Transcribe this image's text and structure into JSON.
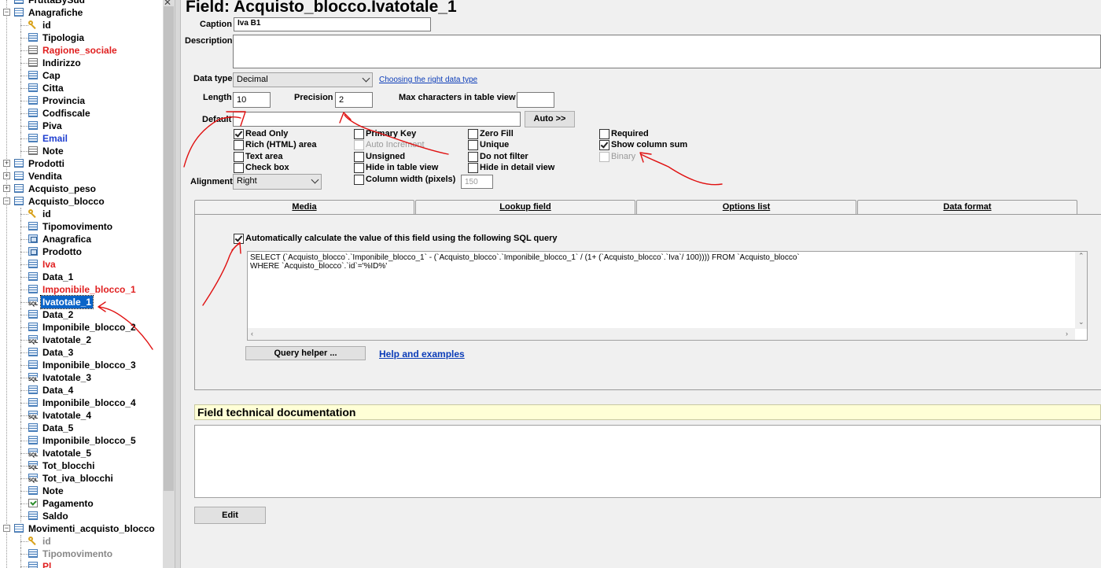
{
  "tree": {
    "items": [
      {
        "label": "FruttaBySud",
        "icon": "database-icon",
        "level": 0,
        "expander": "",
        "color": "normal"
      },
      {
        "label": "Anagrafiche",
        "icon": "table-icon",
        "level": 0,
        "expander": "−",
        "color": "normal"
      },
      {
        "label": "id",
        "icon": "key-icon",
        "level": 1,
        "color": "normal"
      },
      {
        "label": "Tipologia",
        "icon": "field-icon",
        "level": 1,
        "color": "normal"
      },
      {
        "label": "Ragione_sociale",
        "icon": "memo-icon",
        "level": 1,
        "color": "red"
      },
      {
        "label": "Indirizzo",
        "icon": "memo-icon",
        "level": 1,
        "color": "normal"
      },
      {
        "label": "Cap",
        "icon": "field-icon",
        "level": 1,
        "color": "normal"
      },
      {
        "label": "Citta",
        "icon": "field-icon",
        "level": 1,
        "color": "normal"
      },
      {
        "label": "Provincia",
        "icon": "field-icon",
        "level": 1,
        "color": "normal"
      },
      {
        "label": "Codfiscale",
        "icon": "field-icon",
        "level": 1,
        "color": "normal"
      },
      {
        "label": "Piva",
        "icon": "field-icon",
        "level": 1,
        "color": "normal"
      },
      {
        "label": "Email",
        "icon": "field-icon",
        "level": 1,
        "color": "blue"
      },
      {
        "label": "Note",
        "icon": "memo-icon",
        "level": 1,
        "color": "normal"
      },
      {
        "label": "Prodotti",
        "icon": "table-icon",
        "level": 0,
        "expander": "+",
        "color": "normal"
      },
      {
        "label": "Vendita",
        "icon": "table-icon",
        "level": 0,
        "expander": "+",
        "color": "normal"
      },
      {
        "label": "Acquisto_peso",
        "icon": "table-icon",
        "level": 0,
        "expander": "+",
        "color": "normal"
      },
      {
        "label": "Acquisto_blocco",
        "icon": "table-icon",
        "level": 0,
        "expander": "−",
        "color": "normal"
      },
      {
        "label": "id",
        "icon": "key-icon",
        "level": 1,
        "color": "normal"
      },
      {
        "label": "Tipomovimento",
        "icon": "field-icon",
        "level": 1,
        "color": "normal"
      },
      {
        "label": "Anagrafica",
        "icon": "lookup-icon",
        "level": 1,
        "color": "normal"
      },
      {
        "label": "Prodotto",
        "icon": "lookup-icon",
        "level": 1,
        "color": "normal"
      },
      {
        "label": "Iva",
        "icon": "field-icon",
        "level": 1,
        "color": "red"
      },
      {
        "label": "Data_1",
        "icon": "field-icon",
        "level": 1,
        "color": "normal"
      },
      {
        "label": "Imponibile_blocco_1",
        "icon": "field-icon",
        "level": 1,
        "color": "red"
      },
      {
        "label": "Ivatotale_1",
        "icon": "sql-icon",
        "level": 1,
        "color": "selected"
      },
      {
        "label": "Data_2",
        "icon": "field-icon",
        "level": 1,
        "color": "normal"
      },
      {
        "label": "Imponibile_blocco_2",
        "icon": "field-icon",
        "level": 1,
        "color": "normal"
      },
      {
        "label": "Ivatotale_2",
        "icon": "sql-icon",
        "level": 1,
        "color": "normal"
      },
      {
        "label": "Data_3",
        "icon": "field-icon",
        "level": 1,
        "color": "normal"
      },
      {
        "label": "Imponibile_blocco_3",
        "icon": "field-icon",
        "level": 1,
        "color": "normal"
      },
      {
        "label": "Ivatotale_3",
        "icon": "sql-icon",
        "level": 1,
        "color": "normal"
      },
      {
        "label": "Data_4",
        "icon": "field-icon",
        "level": 1,
        "color": "normal"
      },
      {
        "label": "Imponibile_blocco_4",
        "icon": "field-icon",
        "level": 1,
        "color": "normal"
      },
      {
        "label": "Ivatotale_4",
        "icon": "sql-icon",
        "level": 1,
        "color": "normal"
      },
      {
        "label": "Data_5",
        "icon": "field-icon",
        "level": 1,
        "color": "normal"
      },
      {
        "label": "Imponibile_blocco_5",
        "icon": "field-icon",
        "level": 1,
        "color": "normal"
      },
      {
        "label": "Ivatotale_5",
        "icon": "sql-icon",
        "level": 1,
        "color": "normal"
      },
      {
        "label": "Tot_blocchi",
        "icon": "sql-icon",
        "level": 1,
        "color": "normal"
      },
      {
        "label": "Tot_iva_blocchi",
        "icon": "sql-icon",
        "level": 1,
        "color": "normal"
      },
      {
        "label": "Note",
        "icon": "field-icon",
        "level": 1,
        "color": "normal"
      },
      {
        "label": "Pagamento",
        "icon": "check-icon",
        "level": 1,
        "color": "normal"
      },
      {
        "label": "Saldo",
        "icon": "field-icon",
        "level": 1,
        "color": "normal"
      },
      {
        "label": "Movimenti_acquisto_blocco",
        "icon": "table-icon",
        "level": 0,
        "expander": "−",
        "color": "normal"
      },
      {
        "label": "id",
        "icon": "key-icon",
        "level": 1,
        "color": "grey"
      },
      {
        "label": "Tipomovimento",
        "icon": "field-icon",
        "level": 1,
        "color": "grey"
      },
      {
        "label": "Pl",
        "icon": "field-icon",
        "level": 1,
        "color": "red"
      }
    ]
  },
  "field": {
    "title": "Field: Acquisto_blocco.Ivatotale_1",
    "caption_label": "Caption",
    "caption_value": "Iva B1",
    "description_label": "Description",
    "description_value": "",
    "datatype_label": "Data type",
    "datatype_value": "Decimal",
    "datatype_link": "Choosing the right data type",
    "length_label": "Length",
    "length_value": "10",
    "precision_label": "Precision",
    "precision_value": "2",
    "maxchars_label": "Max characters in table view",
    "maxchars_value": "",
    "default_label": "Default",
    "default_value": "",
    "auto_button": "Auto >>",
    "alignment_label": "Alignment",
    "alignment_value": "Right",
    "column_width_value": "150"
  },
  "options": {
    "read_only": "Read Only",
    "rich_html": "Rich (HTML) area",
    "text_area": "Text area",
    "check_box": "Check box",
    "primary_key": "Primary Key",
    "auto_increment": "Auto Increment",
    "unsigned": "Unsigned",
    "hide_table": "Hide in table view",
    "column_width": "Column width (pixels)",
    "zero_fill": "Zero Fill",
    "unique": "Unique",
    "do_not_filter": "Do not filter",
    "hide_detail": "Hide in detail view",
    "required": "Required",
    "show_column_sum": "Show column sum",
    "binary": "Binary"
  },
  "tabs": [
    "Media",
    "Lookup field",
    "Options list",
    "Data format"
  ],
  "sql": {
    "auto_calc_label": "Automatically calculate the value of this field using the following SQL query",
    "query_line1": "SELECT (`Acquisto_blocco`.`Imponibile_blocco_1` - (`Acquisto_blocco`.`Imponibile_blocco_1` / (1+ (`Acquisto_blocco`.`Iva`/ 100)))) FROM `Acquisto_blocco`",
    "query_line2": "WHERE `Acquisto_blocco`.`id`='%ID%'",
    "query_helper_button": "Query helper ...",
    "help_link": "Help and examples"
  },
  "doc": {
    "title": "Field technical documentation",
    "content": ""
  },
  "edit_button": "Edit",
  "colors": {
    "selection": "#0a64c8",
    "highlight_red": "#e02020",
    "link_blue": "#0b3cb8",
    "annotation_red": "#e01010",
    "doc_bar": "#ffffd6"
  }
}
